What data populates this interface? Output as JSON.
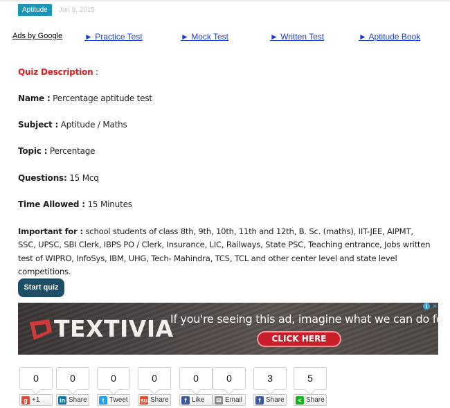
{
  "post": {
    "tag": "Aptitude",
    "date": "Jun 9, 2015"
  },
  "ad_links": {
    "ads_by": "Ads by Google",
    "items": [
      "► Practice Test",
      "► Mock Test",
      "► Written Test",
      "► Aptitude Book"
    ]
  },
  "quiz": {
    "heading": "Quiz Description",
    "heading_suffix": " :",
    "name_label": "Name :",
    "name_value": " Percentage aptitude test",
    "subject_label": "Subject :",
    "subject_value": " Aptitude / Maths",
    "topic_label": "Topic :",
    "topic_value": " Percentage",
    "questions_label": "Questions:",
    "questions_value": " 15 Mcq",
    "time_label": "Time Allowed :",
    "time_value": " 15 Minutes",
    "important_label": "Important for :",
    "important_value": " school students of class 8th, 9th, 10th, 11th and 12th, B. Sc. (maths), IIT-JEE, AIPMT, SSC, UPSC, SBI Clerk, IBPS PO / Clerk, Insurance, LIC, Railways, State PSC, Teaching entrance, Jobs written test of WIPRO, InfoSys, IBM, UHG, Tech- Mahindra, TCS, TCL and other center level and state level competitions.",
    "start_button": "Start quiz"
  },
  "banner": {
    "brand": "TEXTIVIA",
    "headline": "If you're seeing this ad, imagine what we can do for you.",
    "cta": "CLICK HERE",
    "adchoices_i": "i",
    "adchoices_x": "✕"
  },
  "share_buttons": [
    {
      "count": "0",
      "label": "+1",
      "icon_glyph": "g",
      "icon_name": "google-plus-icon",
      "color": "#dd4b39"
    },
    {
      "count": "0",
      "label": "Share",
      "icon_glyph": "in",
      "icon_name": "linkedin-icon",
      "color": "#0e76a8"
    },
    {
      "count": "0",
      "label": "Tweet",
      "icon_glyph": "t",
      "icon_name": "twitter-icon",
      "color": "#1da1f2"
    },
    {
      "count": "0",
      "label": "Share",
      "icon_glyph": "su",
      "icon_name": "stumbleupon-icon",
      "color": "#eb4924"
    },
    {
      "count": "0",
      "label": "Like",
      "icon_glyph": "f",
      "icon_name": "facebook-icon",
      "color": "#3b5998"
    },
    {
      "count": "0",
      "label": "Email",
      "icon_glyph": "✉",
      "icon_name": "email-icon",
      "color": "#888888"
    },
    {
      "count": "3",
      "label": "Share",
      "icon_glyph": "f",
      "icon_name": "facebook-share-icon",
      "color": "#3b5998"
    },
    {
      "count": "5",
      "label": "Share",
      "icon_glyph": "<",
      "icon_name": "share-icon",
      "color": "#14b31f"
    }
  ]
}
